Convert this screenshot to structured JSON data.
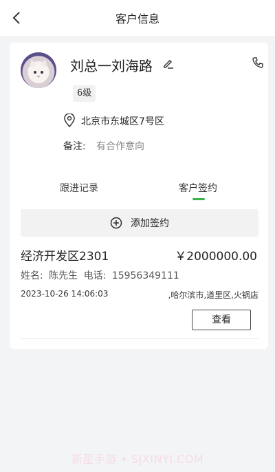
{
  "header": {
    "title": "客户信息"
  },
  "customer": {
    "name": "刘总一刘海路",
    "level": "6级",
    "address": "北京市东城区7号区",
    "note_label": "备注:",
    "note_value": "有合作意向"
  },
  "tabs": [
    {
      "label": "跟进记录",
      "active": false
    },
    {
      "label": "客户签约",
      "active": true
    }
  ],
  "add_contract_label": "添加签约",
  "contract": {
    "name": "经济开发区2301",
    "amount": "￥2000000.00",
    "contact_label": "姓名:",
    "contact_name": "陈先生",
    "phone_label": "电话:",
    "phone": "15956349111",
    "datetime": "2023-10-26 14:06:03",
    "location": ",哈尔滨市,道里区,火锅店",
    "view_label": "查看"
  },
  "watermark": "新星手游 • SJXINYI.COM",
  "colors": {
    "accent": "#3bb34a",
    "background": "#f3f4f6"
  }
}
